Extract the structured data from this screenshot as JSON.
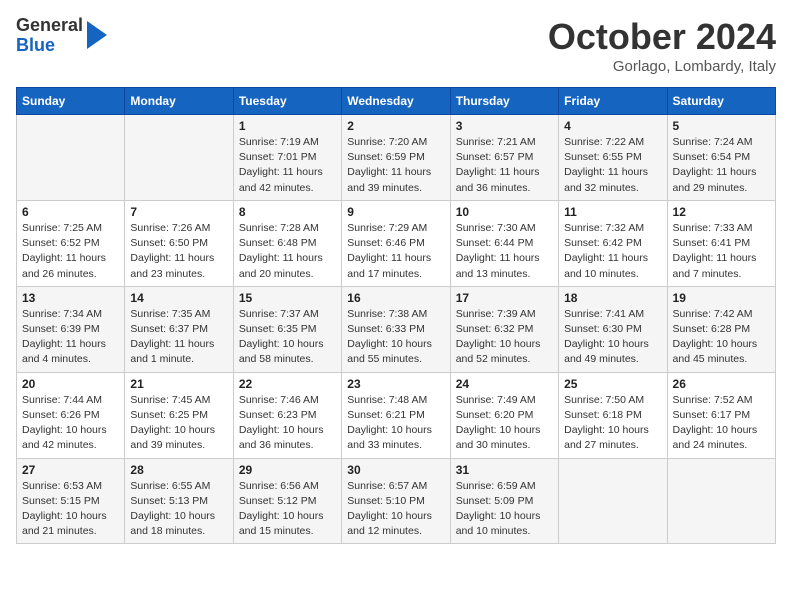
{
  "logo": {
    "line1": "General",
    "line2": "Blue"
  },
  "title": "October 2024",
  "location": "Gorlago, Lombardy, Italy",
  "headers": [
    "Sunday",
    "Monday",
    "Tuesday",
    "Wednesday",
    "Thursday",
    "Friday",
    "Saturday"
  ],
  "weeks": [
    [
      {
        "day": "",
        "info": ""
      },
      {
        "day": "",
        "info": ""
      },
      {
        "day": "1",
        "info": "Sunrise: 7:19 AM\nSunset: 7:01 PM\nDaylight: 11 hours and 42 minutes."
      },
      {
        "day": "2",
        "info": "Sunrise: 7:20 AM\nSunset: 6:59 PM\nDaylight: 11 hours and 39 minutes."
      },
      {
        "day": "3",
        "info": "Sunrise: 7:21 AM\nSunset: 6:57 PM\nDaylight: 11 hours and 36 minutes."
      },
      {
        "day": "4",
        "info": "Sunrise: 7:22 AM\nSunset: 6:55 PM\nDaylight: 11 hours and 32 minutes."
      },
      {
        "day": "5",
        "info": "Sunrise: 7:24 AM\nSunset: 6:54 PM\nDaylight: 11 hours and 29 minutes."
      }
    ],
    [
      {
        "day": "6",
        "info": "Sunrise: 7:25 AM\nSunset: 6:52 PM\nDaylight: 11 hours and 26 minutes."
      },
      {
        "day": "7",
        "info": "Sunrise: 7:26 AM\nSunset: 6:50 PM\nDaylight: 11 hours and 23 minutes."
      },
      {
        "day": "8",
        "info": "Sunrise: 7:28 AM\nSunset: 6:48 PM\nDaylight: 11 hours and 20 minutes."
      },
      {
        "day": "9",
        "info": "Sunrise: 7:29 AM\nSunset: 6:46 PM\nDaylight: 11 hours and 17 minutes."
      },
      {
        "day": "10",
        "info": "Sunrise: 7:30 AM\nSunset: 6:44 PM\nDaylight: 11 hours and 13 minutes."
      },
      {
        "day": "11",
        "info": "Sunrise: 7:32 AM\nSunset: 6:42 PM\nDaylight: 11 hours and 10 minutes."
      },
      {
        "day": "12",
        "info": "Sunrise: 7:33 AM\nSunset: 6:41 PM\nDaylight: 11 hours and 7 minutes."
      }
    ],
    [
      {
        "day": "13",
        "info": "Sunrise: 7:34 AM\nSunset: 6:39 PM\nDaylight: 11 hours and 4 minutes."
      },
      {
        "day": "14",
        "info": "Sunrise: 7:35 AM\nSunset: 6:37 PM\nDaylight: 11 hours and 1 minute."
      },
      {
        "day": "15",
        "info": "Sunrise: 7:37 AM\nSunset: 6:35 PM\nDaylight: 10 hours and 58 minutes."
      },
      {
        "day": "16",
        "info": "Sunrise: 7:38 AM\nSunset: 6:33 PM\nDaylight: 10 hours and 55 minutes."
      },
      {
        "day": "17",
        "info": "Sunrise: 7:39 AM\nSunset: 6:32 PM\nDaylight: 10 hours and 52 minutes."
      },
      {
        "day": "18",
        "info": "Sunrise: 7:41 AM\nSunset: 6:30 PM\nDaylight: 10 hours and 49 minutes."
      },
      {
        "day": "19",
        "info": "Sunrise: 7:42 AM\nSunset: 6:28 PM\nDaylight: 10 hours and 45 minutes."
      }
    ],
    [
      {
        "day": "20",
        "info": "Sunrise: 7:44 AM\nSunset: 6:26 PM\nDaylight: 10 hours and 42 minutes."
      },
      {
        "day": "21",
        "info": "Sunrise: 7:45 AM\nSunset: 6:25 PM\nDaylight: 10 hours and 39 minutes."
      },
      {
        "day": "22",
        "info": "Sunrise: 7:46 AM\nSunset: 6:23 PM\nDaylight: 10 hours and 36 minutes."
      },
      {
        "day": "23",
        "info": "Sunrise: 7:48 AM\nSunset: 6:21 PM\nDaylight: 10 hours and 33 minutes."
      },
      {
        "day": "24",
        "info": "Sunrise: 7:49 AM\nSunset: 6:20 PM\nDaylight: 10 hours and 30 minutes."
      },
      {
        "day": "25",
        "info": "Sunrise: 7:50 AM\nSunset: 6:18 PM\nDaylight: 10 hours and 27 minutes."
      },
      {
        "day": "26",
        "info": "Sunrise: 7:52 AM\nSunset: 6:17 PM\nDaylight: 10 hours and 24 minutes."
      }
    ],
    [
      {
        "day": "27",
        "info": "Sunrise: 6:53 AM\nSunset: 5:15 PM\nDaylight: 10 hours and 21 minutes."
      },
      {
        "day": "28",
        "info": "Sunrise: 6:55 AM\nSunset: 5:13 PM\nDaylight: 10 hours and 18 minutes."
      },
      {
        "day": "29",
        "info": "Sunrise: 6:56 AM\nSunset: 5:12 PM\nDaylight: 10 hours and 15 minutes."
      },
      {
        "day": "30",
        "info": "Sunrise: 6:57 AM\nSunset: 5:10 PM\nDaylight: 10 hours and 12 minutes."
      },
      {
        "day": "31",
        "info": "Sunrise: 6:59 AM\nSunset: 5:09 PM\nDaylight: 10 hours and 10 minutes."
      },
      {
        "day": "",
        "info": ""
      },
      {
        "day": "",
        "info": ""
      }
    ]
  ]
}
